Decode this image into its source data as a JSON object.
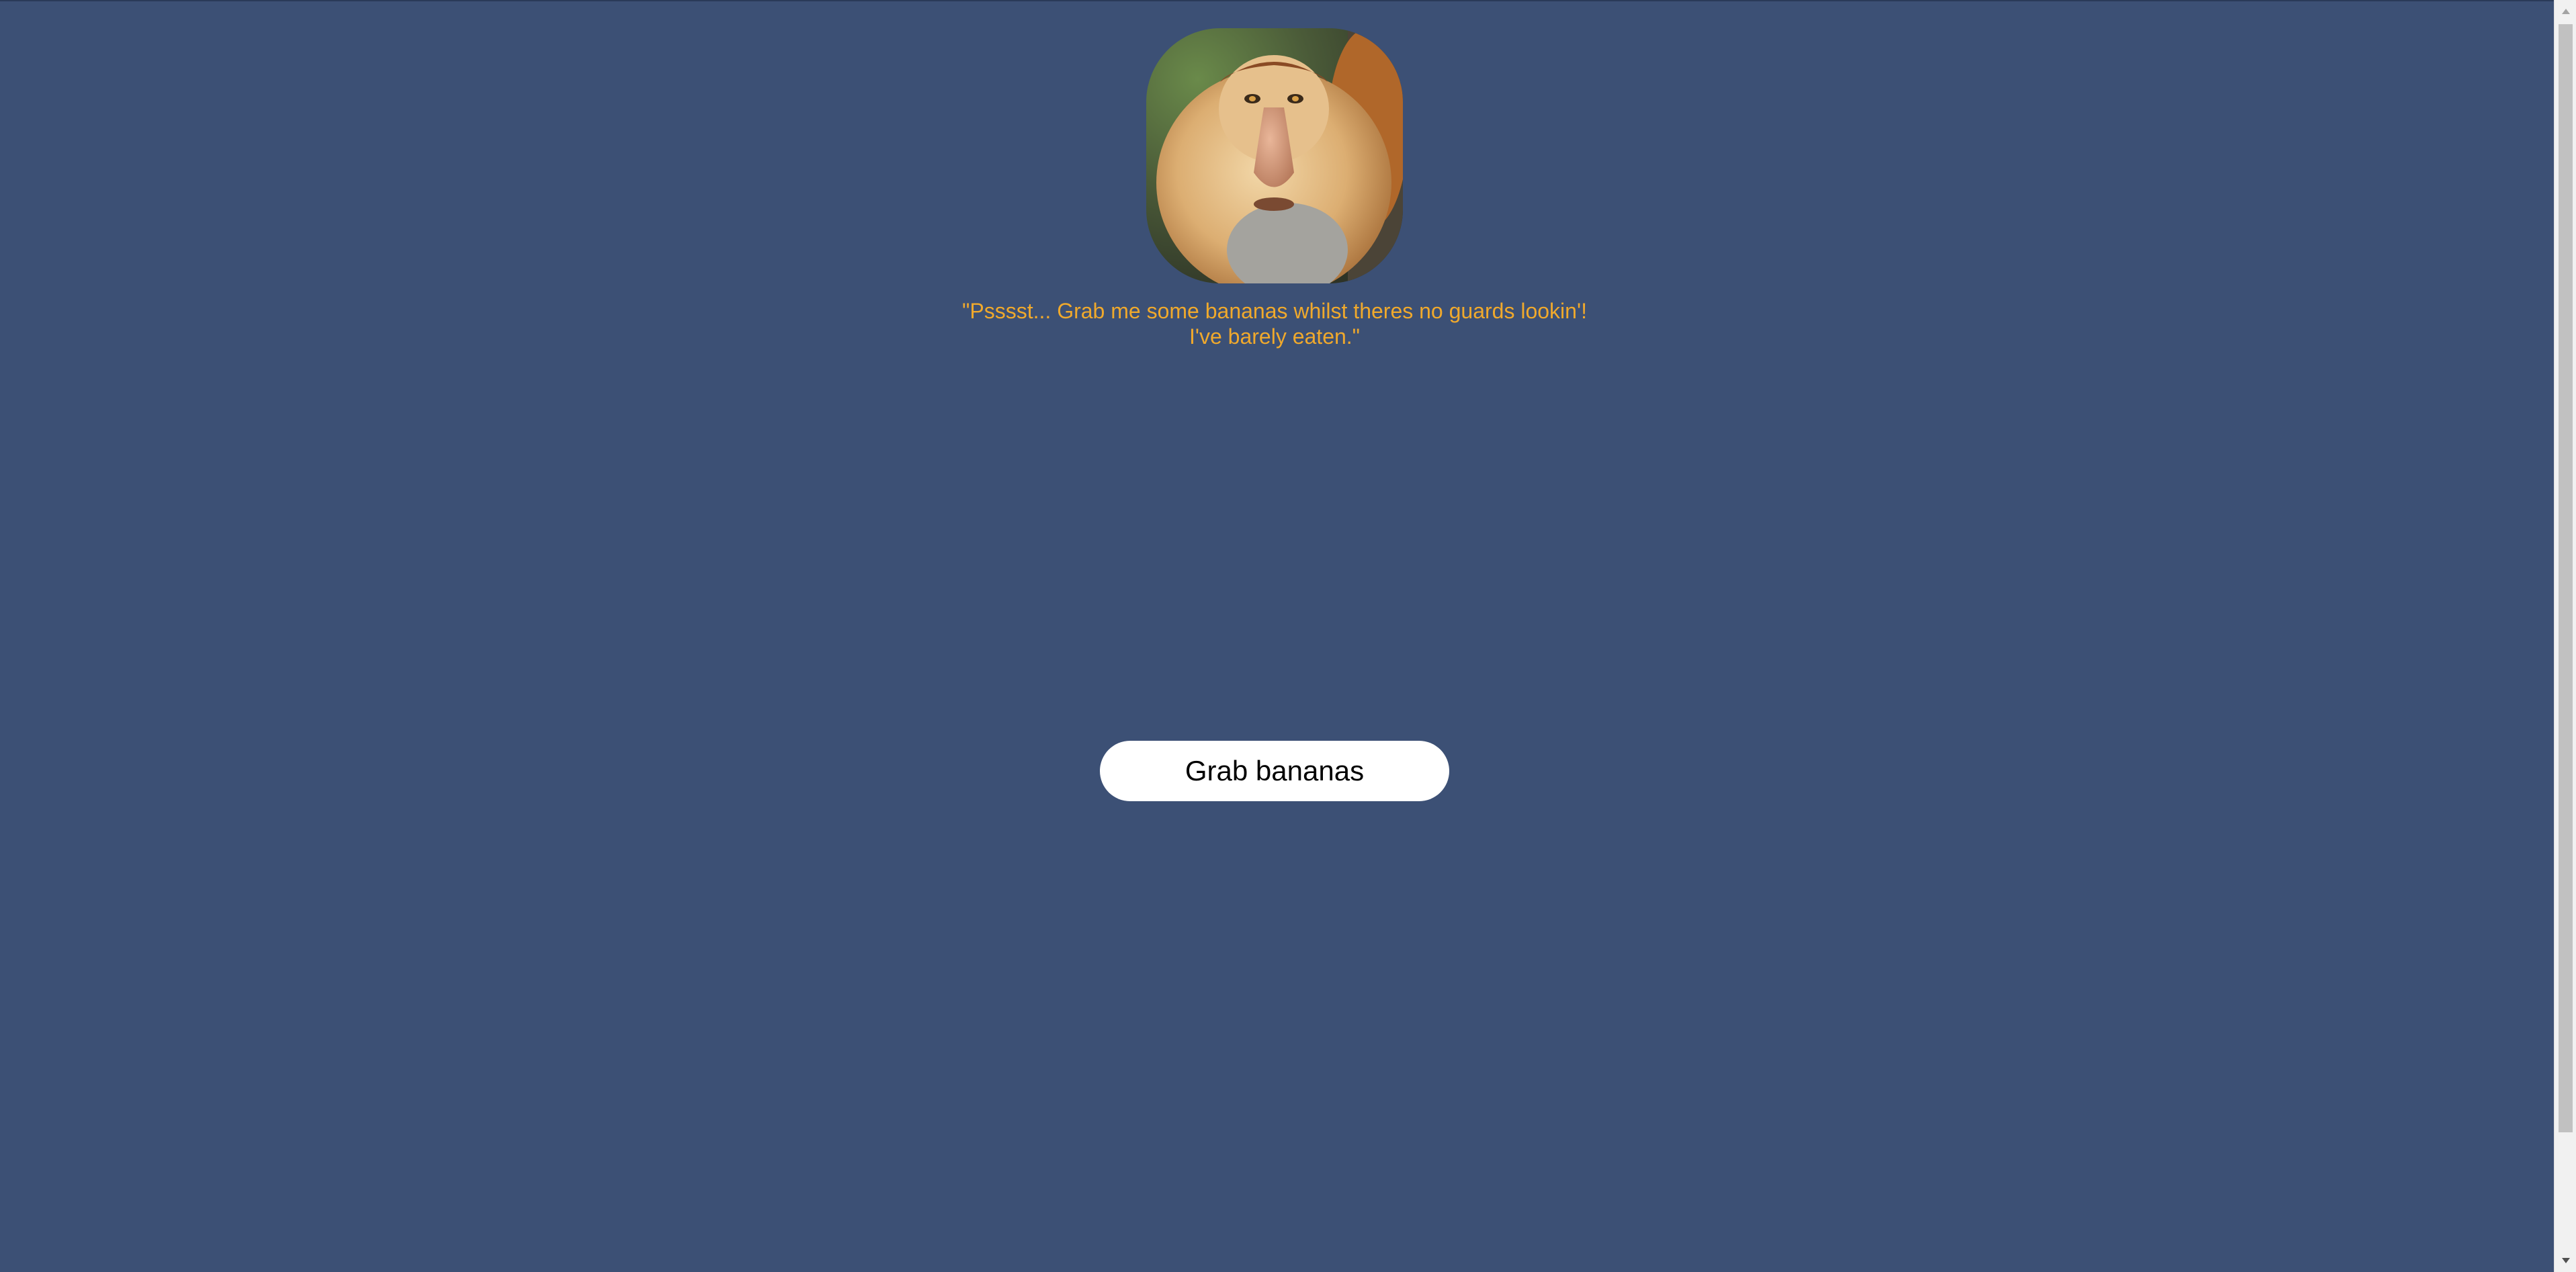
{
  "monkey": {
    "image_alt": "proboscis monkey portrait",
    "quote_line_1": "\"Psssst... Grab me some bananas whilst theres no guards lookin'!",
    "quote_line_2": "I've barely eaten.\""
  },
  "actions": {
    "grab_label": "Grab bananas"
  },
  "colors": {
    "background": "#3c5075",
    "quote_text": "#f0a92c",
    "button_bg": "#ffffff"
  },
  "icons": {
    "scroll_up": "triangle-up",
    "scroll_down": "triangle-down"
  }
}
